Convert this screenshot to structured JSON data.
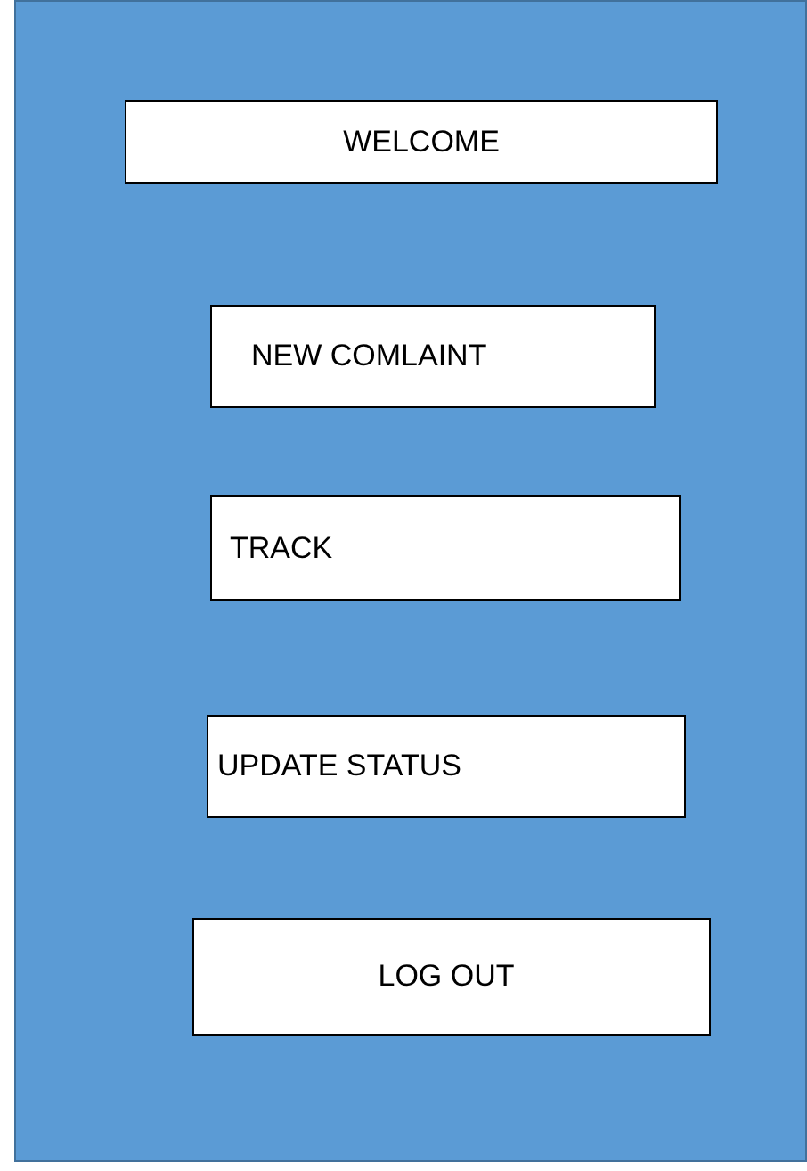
{
  "title": "WELCOME",
  "buttons": [
    {
      "label": "NEW COMLAINT"
    },
    {
      "label": "TRACK"
    },
    {
      "label": "UPDATE STATUS"
    },
    {
      "label": "LOG OUT"
    }
  ]
}
